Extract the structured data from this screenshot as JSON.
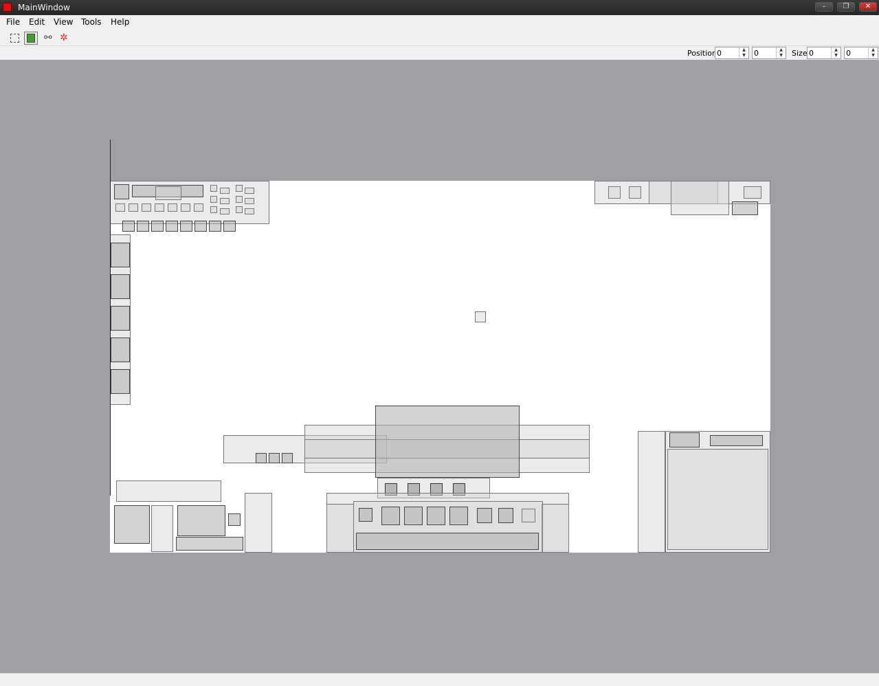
{
  "window": {
    "title": "MainWindow",
    "min": "–",
    "max": "❐",
    "close": "✕"
  },
  "menu": {
    "file": "File",
    "edit": "Edit",
    "view": "View",
    "tools": "Tools",
    "help": "Help"
  },
  "properties": {
    "position_label": "Position",
    "position_x": "0",
    "position_y": "0",
    "size_label": "Size",
    "size_w": "0",
    "size_h": "0"
  },
  "icons": {
    "select": "select-rectangle-icon",
    "component": "component-icon",
    "link": "link-icon",
    "unlink": "unlink-icon"
  },
  "colors": {
    "canvas": "#a09fa4",
    "board": "#ffffff",
    "titlebar": "#2e2e2e",
    "app_icon": "#e01010"
  }
}
